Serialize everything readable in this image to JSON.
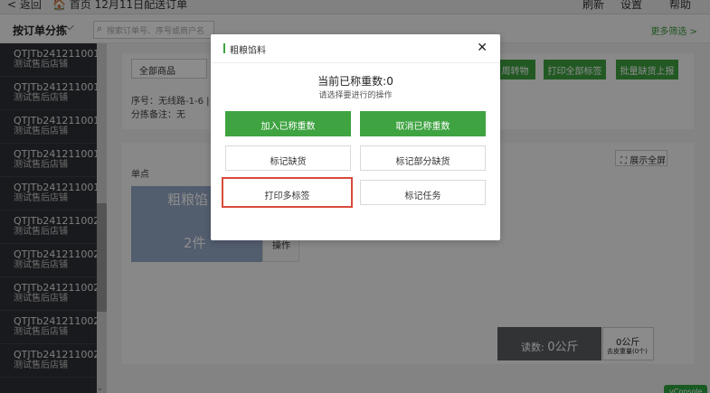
{
  "topbar": {
    "back": "< 返回",
    "home_title": "🏠 首页 12月11日配送订单",
    "refresh": "刷新",
    "settings": "设置",
    "help": "帮助"
  },
  "subbar": {
    "group": "按订单分拣",
    "search_placeholder": "搜索订单号、序号或商户名",
    "more": "更多筛选 >"
  },
  "orders": [
    {
      "code": "QTJTb241211001",
      "sub": "测试售后店铺"
    },
    {
      "code": "QTJTb241211001",
      "sub": "测试售后店铺"
    },
    {
      "code": "QTJTb241211001",
      "sub": "测试售后店铺"
    },
    {
      "code": "QTJTb241211001",
      "sub": "测试售后店铺"
    },
    {
      "code": "QTJTb241211001",
      "sub": "测试售后店铺"
    },
    {
      "code": "QTJTb241211002",
      "sub": "测试售后店铺"
    },
    {
      "code": "QTJTb241211002",
      "sub": "测试售后店铺"
    },
    {
      "code": "QTJTb241211002",
      "sub": "测试售后店铺"
    },
    {
      "code": "QTJTb241211002",
      "sub": "测试售后店铺"
    },
    {
      "code": "QTJTb241211002",
      "sub": "测试售后店铺"
    }
  ],
  "filter": {
    "select": "全部商品",
    "seq": "序号：无线路-1-6 |",
    "remark": "分拣备注：无"
  },
  "actions": {
    "transfer": "周转物",
    "print_all": "打印全部标签",
    "batch_report": "批量缺货上报"
  },
  "section": {
    "single": "单点",
    "fullscreen": "展示全屏"
  },
  "product": {
    "name": "粗粮馅",
    "count": "2件",
    "op": "操作"
  },
  "scale": {
    "read_label": "读数:",
    "read_value": "0公斤",
    "weight": "0公斤",
    "tare": "去皮重量(0个)"
  },
  "vconsole": "vConsole",
  "modal": {
    "title": "粗粮馅料",
    "count_text": "当前已称重数:0",
    "hint": "请选择要进行的操作",
    "add_weighed": "加入已称重数",
    "cancel_weighed": "取消已称重数",
    "mark_short": "标记缺货",
    "mark_partial_short": "标记部分缺货",
    "print_multi_labels": "打印多标签",
    "mark_task": "标记任务"
  },
  "colors": {
    "accent_green": "#3fa341",
    "focus_red": "#d84a3a",
    "sidebar_bg": "#2f3136"
  },
  "icons": {
    "close": "close-icon",
    "back": "chevron-left-icon",
    "refresh": "refresh-icon",
    "settings": "gear-icon",
    "search": "search-icon"
  }
}
